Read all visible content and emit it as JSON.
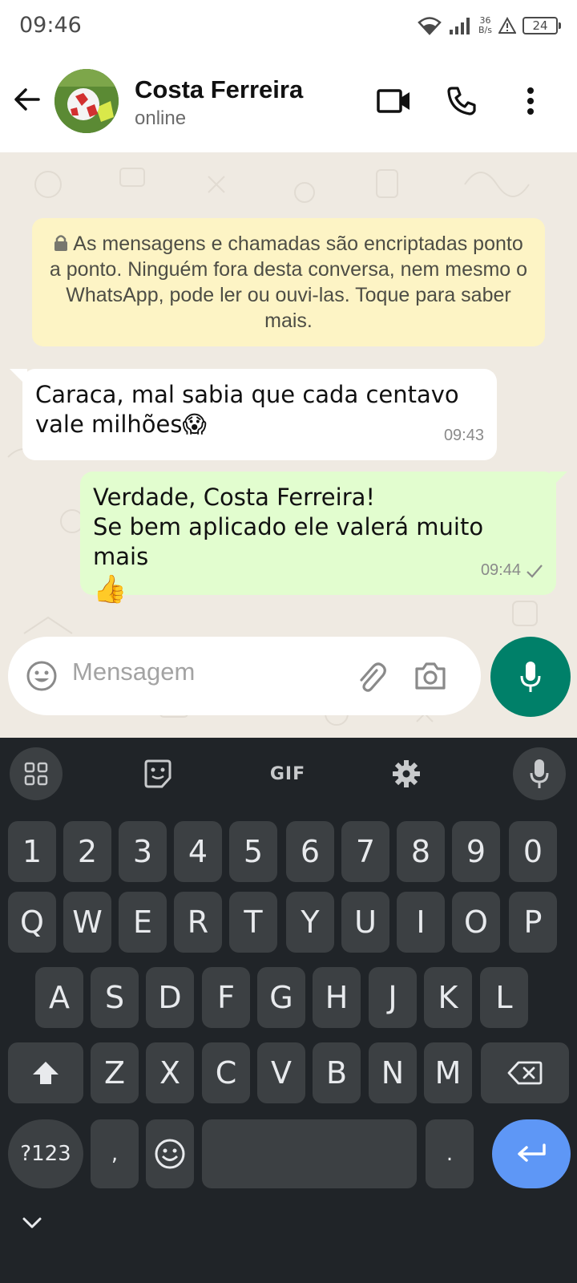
{
  "status_bar": {
    "time": "09:46",
    "net_speed_value": "36",
    "net_speed_unit": "B/s",
    "battery": "24",
    "icons": [
      "wifi-icon",
      "signal-icon",
      "alert-icon",
      "battery-icon"
    ]
  },
  "header": {
    "contact_name": "Costa Ferreira",
    "contact_status": "online",
    "icons": [
      "back-arrow-icon",
      "video-call-icon",
      "voice-call-icon",
      "more-options-icon"
    ]
  },
  "chat": {
    "encryption_notice": "As mensagens e chamadas são encriptadas ponto a ponto. Ninguém fora desta conversa, nem mesmo o WhatsApp, pode ler ou ouvi-las. Toque para saber mais.",
    "messages": [
      {
        "direction": "incoming",
        "lines": [
          "Caraca, mal sabia que cada centavo",
          "vale milhões😱"
        ],
        "time": "09:43"
      },
      {
        "direction": "outgoing",
        "lines": [
          "Verdade, Costa Ferreira!",
          "Se bem aplicado ele valerá muito mais",
          "👍"
        ],
        "time": "09:44",
        "status": "sent"
      }
    ]
  },
  "input": {
    "placeholder": "Mensagem",
    "icons": [
      "emoji-icon",
      "attach-icon",
      "camera-icon",
      "mic-icon"
    ]
  },
  "keyboard": {
    "toolbar_gif": "GIF",
    "number_row": [
      "1",
      "2",
      "3",
      "4",
      "5",
      "6",
      "7",
      "8",
      "9",
      "0"
    ],
    "row1": [
      "Q",
      "W",
      "E",
      "R",
      "T",
      "Y",
      "U",
      "I",
      "O",
      "P"
    ],
    "row2": [
      "A",
      "S",
      "D",
      "F",
      "G",
      "H",
      "J",
      "K",
      "L"
    ],
    "row3": [
      "Z",
      "X",
      "C",
      "V",
      "B",
      "N",
      "M"
    ],
    "symbols_key": "?123",
    "comma_key": ",",
    "period_key": "."
  },
  "colors": {
    "chat_bg": "#efeae2",
    "outgoing_bubble": "#e2fdcf",
    "notice_bg": "#fdf4c5",
    "accent": "#008069",
    "keyboard_bg": "#202428",
    "key_bg": "#3c4043",
    "enter_key": "#5e97f6"
  }
}
